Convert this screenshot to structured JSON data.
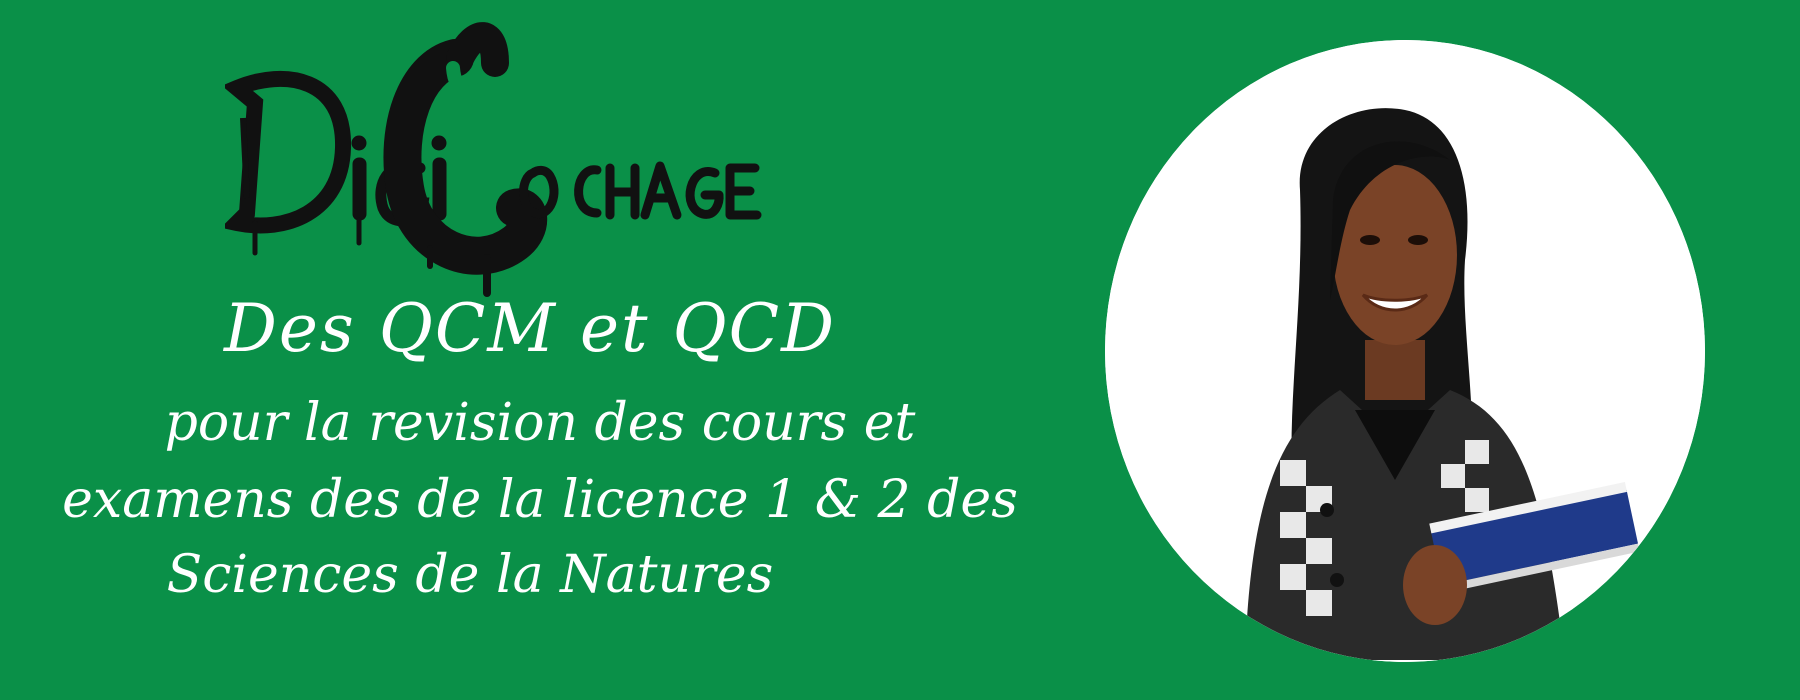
{
  "logo": {
    "text": "DigiCochage"
  },
  "headline": {
    "line1": "Des QCM et QCD",
    "line2": "pour la revision des cours et",
    "line3": "examens des de la licence 1 & 2 des",
    "line4": "Sciences de la Natures"
  },
  "colors": {
    "background": "#0a9048",
    "text": "#ffffff",
    "logo": "#111111"
  },
  "photo": {
    "subject": "smiling-student-holding-books"
  }
}
